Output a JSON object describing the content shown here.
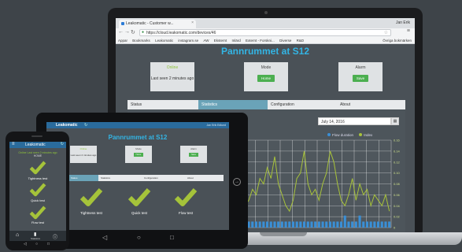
{
  "laptop": {
    "browser": {
      "tab_title": "Leakomatic - Customer w...",
      "tab_close": "×",
      "user_badge": "Jan Erik",
      "url": "https://cloud.leakomatic.com/devices/46",
      "bookmarks": [
        "Appar",
        "Bookmarks",
        "Leakomatic",
        "instagram.se",
        "AW",
        "Eksternt",
        "Inlärd",
        "Externt - Forskni...",
        "Diverse",
        "R&D"
      ],
      "other_bookmarks": "Övriga bokmärken"
    },
    "page": {
      "title": "Pannrummet at S12",
      "status_card": {
        "title": "Online",
        "text": "Last seen 2 minutes ago"
      },
      "mode_card": {
        "title": "Mode",
        "button": "Home"
      },
      "alarm_card": {
        "title": "Alarm",
        "button": "Save"
      },
      "tabs": [
        "Status",
        "Statistics",
        "Configuration",
        "About"
      ],
      "active_tab": "Statistics",
      "date_value": "July 14, 2016",
      "legend": [
        "Flow duration",
        "Index"
      ]
    }
  },
  "tablet": {
    "logo": "Leakomatic",
    "user": "Jan Erik Edlund",
    "title": "Pannrummet at S12",
    "status_card": {
      "title": "Online",
      "text": "Last seen 2 minutes ago"
    },
    "mode_card": {
      "title": "Mode",
      "button": "Home"
    },
    "alarm_card": {
      "title": "Alarm",
      "button": "Save"
    },
    "tabs": [
      "Status",
      "Statistics",
      "Configuration",
      "About"
    ],
    "tests": [
      "Tightness test",
      "Quick test",
      "Flow test"
    ]
  },
  "phone": {
    "logo": "Leakomatic",
    "status_text": "Online Last seen 2 minutes ago",
    "mode_text": "HOME",
    "tests": [
      "Tightness test",
      "Quick test",
      "Flow test"
    ],
    "bottom_tab_label": "Statistics"
  },
  "colors": {
    "accent": "#33b5e5",
    "online": "#8fc43a",
    "button": "#4caf50",
    "active_tab": "#6aa3b8",
    "series_flow": "#3a8fd6",
    "series_index": "#a8c33a"
  },
  "chart_data": {
    "type": "line",
    "series": [
      {
        "name": "Flow duration",
        "values": [
          0.01,
          0.01,
          0.01,
          0.01,
          0.01,
          0.01,
          0.01,
          0.01,
          0.01,
          0.01,
          0.01,
          0.01,
          0.01,
          0.01,
          0.01,
          0.01,
          0.01,
          0.01,
          0.01,
          0.01,
          0.01,
          0.01,
          0.01,
          0.01,
          0.01,
          0.01,
          0.01,
          0.02,
          0.01,
          0.01,
          0.01,
          0.02,
          0.01,
          0.01,
          0.01,
          0.01,
          0.01,
          0.01,
          0.01,
          0.01
        ]
      },
      {
        "name": "Index",
        "values": [
          0.04,
          0.05,
          0.07,
          0.06,
          0.09,
          0.08,
          0.11,
          0.09,
          0.13,
          0.08,
          0.06,
          0.04,
          0.03,
          0.05,
          0.09,
          0.1,
          0.14,
          0.08,
          0.06,
          0.07,
          0.05,
          0.08,
          0.1,
          0.14,
          0.12,
          0.08,
          0.05,
          0.04,
          0.06,
          0.09,
          0.05,
          0.08,
          0.06,
          0.07,
          0.04,
          0.06,
          0.05,
          0.04,
          0.06,
          0.03
        ]
      }
    ],
    "y_ticks": [
      "0.16",
      "0.14",
      "0.12",
      "0.10",
      "0.08",
      "0.06",
      "0.04",
      "0.02",
      "0"
    ],
    "ylim": [
      0,
      0.16
    ],
    "grid": true,
    "legend": "top-right"
  }
}
